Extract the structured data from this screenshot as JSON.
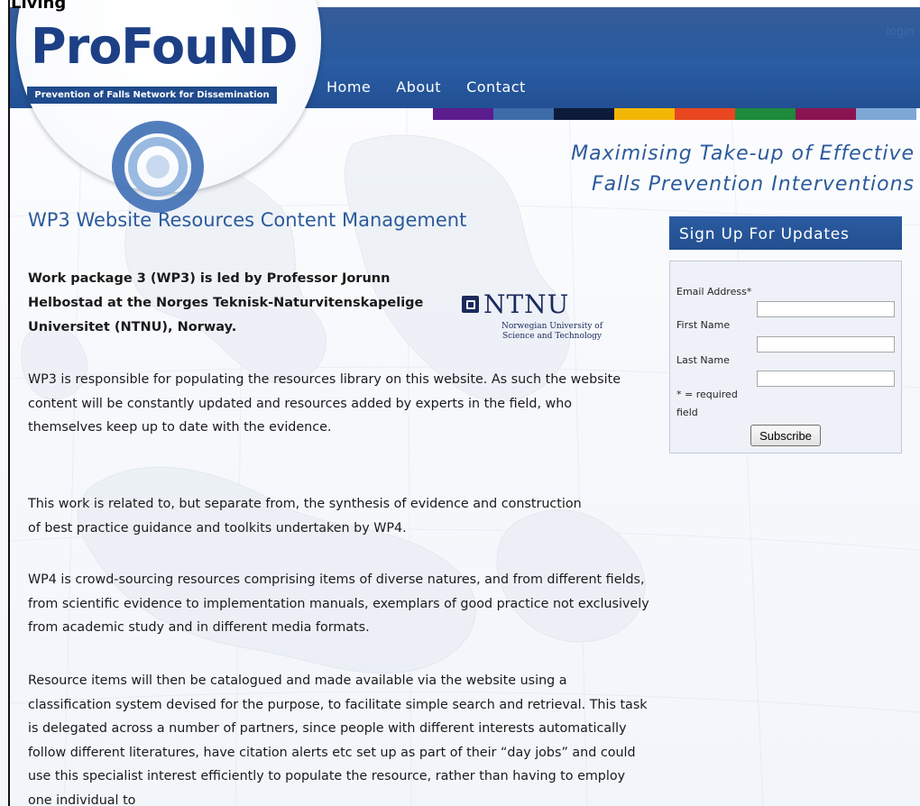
{
  "top_label": "Living",
  "header": {
    "login_label": "login",
    "logo": {
      "name": "ProFouND",
      "subtitle": "Prevention of Falls Network for Dissemination"
    },
    "nav": [
      "Home",
      "About",
      "Contact"
    ],
    "color_strip": [
      "#5b1d8e",
      "#3e6ca8",
      "#0e1a3a",
      "#f2b705",
      "#e8471f",
      "#1d8a3c",
      "#8a1450",
      "#7fa7d6"
    ]
  },
  "tagline": {
    "line1": "Maximising Take-up of Effective",
    "line2": "Falls Prevention Interventions"
  },
  "main": {
    "title": "WP3 Website Resources Content Management",
    "intro": "Work package 3 (WP3) is led by Professor Jorunn Helbostad at the Norges Teknisk-Naturvitenskapelige Universitet (NTNU), Norway.",
    "ntnu_logo": {
      "name": "NTNU",
      "subtitle_line1": "Norwegian University of",
      "subtitle_line2": "Science and Technology"
    },
    "paragraphs": [
      "WP3 is responsible for populating the resources library on this website. As such the website content will be constantly updated and resources added by experts in the field, who themselves keep up to date with the evidence.",
      "This work is related to, but separate from, the synthesis of evidence and construction of best practice guidance and toolkits undertaken by WP4.",
      "WP4 is crowd-sourcing resources comprising items of diverse natures, and from different fields, from scientific evidence to implementation manuals, exemplars of good practice not exclusively from academic study and in different media formats.",
      "Resource items will then be catalogued and made available via the website using a classification system devised for the purpose, to facilitate simple search and retrieval. This task is delegated across a number of partners, since people with different interests automatically follow different literatures, have citation alerts etc set up as part of their “day jobs” and could use this specialist interest efficiently to populate the resource, rather than having to employ one individual to"
    ]
  },
  "signup": {
    "title": "Sign Up For Updates",
    "email_label": "Email Address*",
    "email_value": "",
    "first_name_label": "First Name",
    "first_name_value": "",
    "last_name_label": "Last Name",
    "last_name_value": "",
    "required_line1": "* = required",
    "required_line2": "field",
    "subscribe_label": "Subscribe"
  }
}
